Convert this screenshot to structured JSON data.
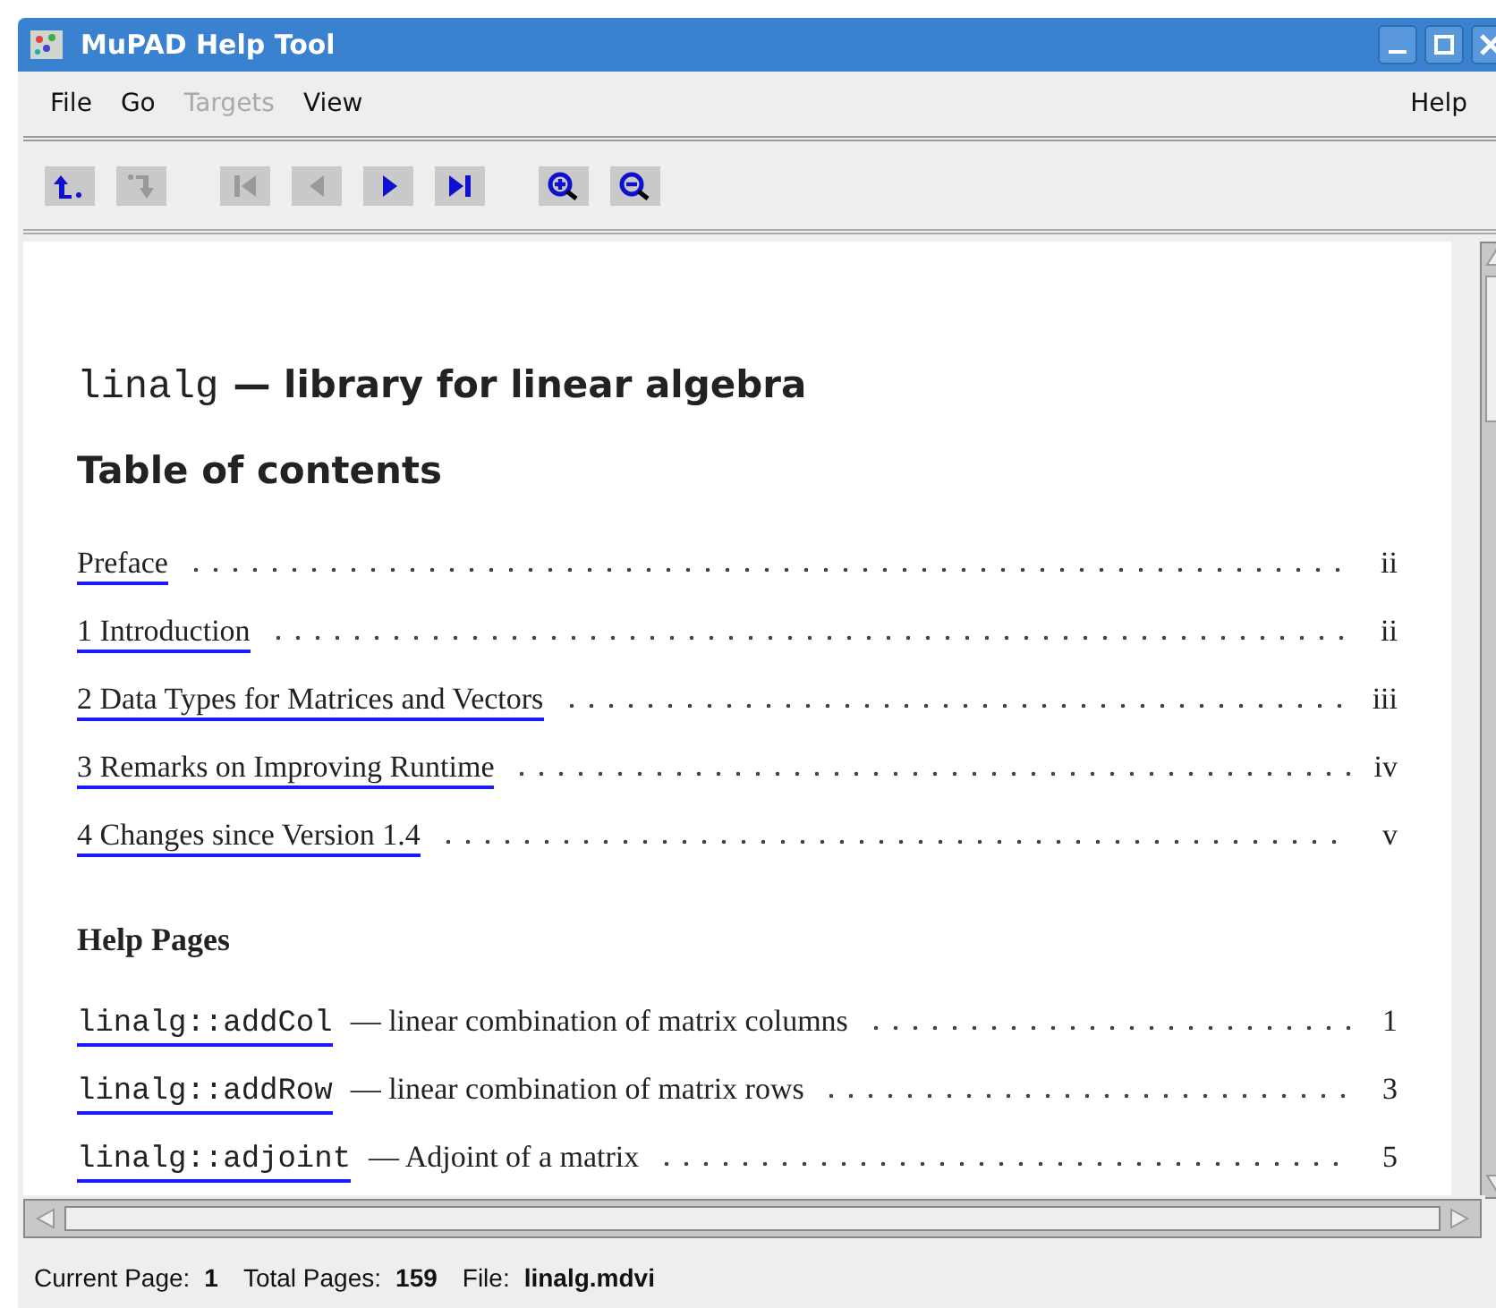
{
  "window": {
    "title": "MuPAD Help Tool"
  },
  "menu": [
    {
      "label": "File",
      "disabled": false
    },
    {
      "label": "Go",
      "disabled": false
    },
    {
      "label": "Targets",
      "disabled": true
    },
    {
      "label": "View",
      "disabled": false
    }
  ],
  "help_menu": {
    "label": "Help"
  },
  "toolbar": [
    {
      "kind": "up",
      "disabled": false
    },
    {
      "kind": "down",
      "disabled": true
    },
    {
      "kind": "first",
      "disabled": true
    },
    {
      "kind": "prev",
      "disabled": true
    },
    {
      "kind": "next",
      "disabled": false
    },
    {
      "kind": "last",
      "disabled": false
    },
    {
      "kind": "zoom-in",
      "disabled": false
    },
    {
      "kind": "zoom-out",
      "disabled": false
    }
  ],
  "document": {
    "title_code": "linalg",
    "title_text": "— library for linear algebra",
    "toc_heading": "Table of contents",
    "toc": [
      {
        "label": "Preface",
        "page": "ii"
      },
      {
        "label": "1 Introduction",
        "page": "ii"
      },
      {
        "label": "2 Data Types for Matrices and Vectors",
        "page": "iii"
      },
      {
        "label": "3 Remarks on Improving Runtime",
        "page": "iv"
      },
      {
        "label": "4 Changes since Version 1.4",
        "page": "v"
      }
    ],
    "help_heading": "Help Pages",
    "help_pages": [
      {
        "name": "linalg::addCol",
        "description": "— linear combination of matrix columns",
        "page": "1"
      },
      {
        "name": "linalg::addRow",
        "description": "— linear combination of matrix rows",
        "page": "3"
      },
      {
        "name": "linalg::adjoint",
        "description": "— Adjoint of a matrix",
        "page": "5"
      }
    ]
  },
  "status_bar": {
    "current_page_label": "Current Page:",
    "current_page": "1",
    "total_pages_label": "Total Pages:",
    "total_pages": "159",
    "file_label": "File:",
    "file": "linalg.mdvi"
  }
}
